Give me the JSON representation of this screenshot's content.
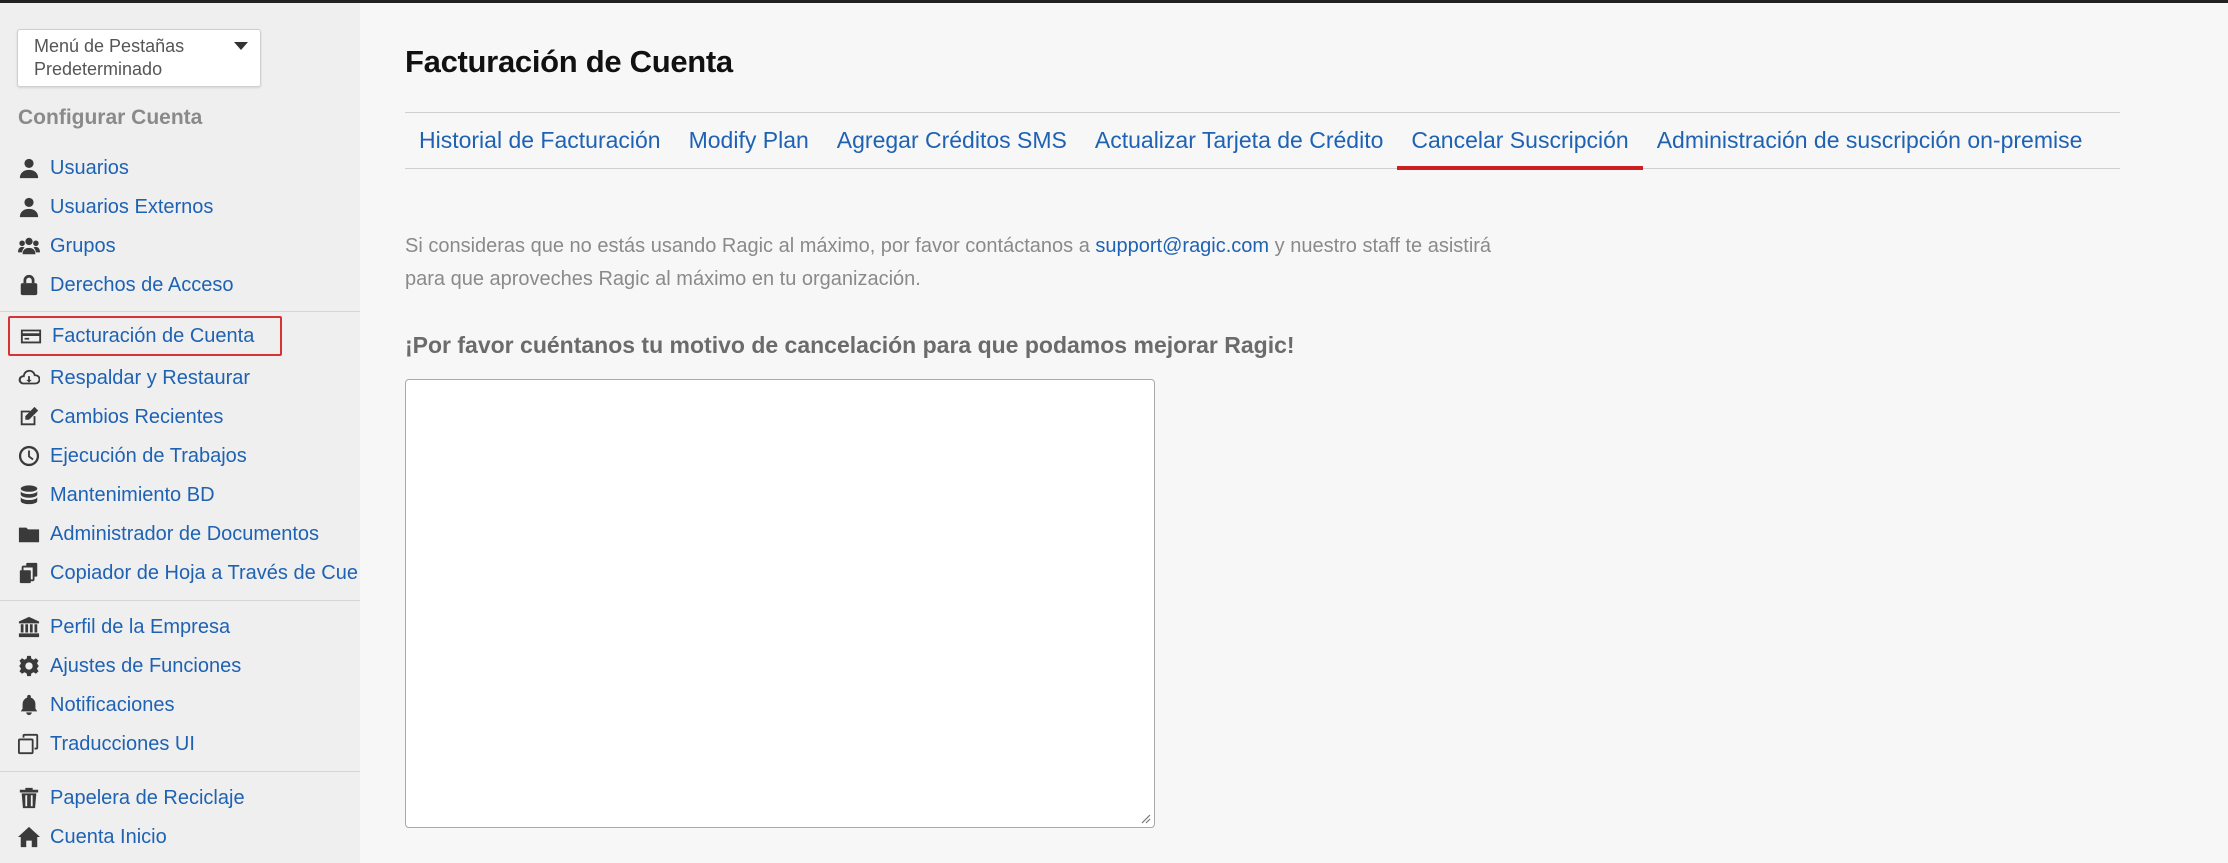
{
  "sidebar": {
    "tab_menu_label": "Menú de Pestañas Predeterminado",
    "section_title": "Configurar Cuenta",
    "items": [
      {
        "label": "Usuarios",
        "icon": "user-icon"
      },
      {
        "label": "Usuarios Externos",
        "icon": "user-icon"
      },
      {
        "label": "Grupos",
        "icon": "users-icon"
      },
      {
        "label": "Derechos de Acceso",
        "icon": "lock-icon"
      },
      {
        "label": "Facturación de Cuenta",
        "icon": "credit-card-icon",
        "active": true
      },
      {
        "label": "Respaldar y Restaurar",
        "icon": "cloud-download-icon"
      },
      {
        "label": "Cambios Recientes",
        "icon": "edit-icon"
      },
      {
        "label": "Ejecución de Trabajos",
        "icon": "clock-icon"
      },
      {
        "label": "Mantenimiento BD",
        "icon": "database-icon"
      },
      {
        "label": "Administrador de Documentos",
        "icon": "folder-icon"
      },
      {
        "label": "Copiador de Hoja a Través de Cue",
        "icon": "copy-sheets-icon"
      },
      {
        "label": "Perfil de la Empresa",
        "icon": "bank-icon"
      },
      {
        "label": "Ajustes de Funciones",
        "icon": "gear-icon"
      },
      {
        "label": "Notificaciones",
        "icon": "bell-icon"
      },
      {
        "label": "Traducciones UI",
        "icon": "translate-icon"
      },
      {
        "label": "Papelera de Reciclaje",
        "icon": "trash-icon"
      },
      {
        "label": "Cuenta Inicio",
        "icon": "home-icon"
      }
    ]
  },
  "main": {
    "title": "Facturación de Cuenta",
    "tabs": [
      {
        "label": "Historial de Facturación"
      },
      {
        "label": "Modify Plan"
      },
      {
        "label": "Agregar Créditos SMS"
      },
      {
        "label": "Actualizar Tarjeta de Crédito"
      },
      {
        "label": "Cancelar Suscripción",
        "active": true
      },
      {
        "label": "Administración de suscripción on-premise"
      }
    ],
    "intro_before": "Si consideras que no estás usando Ragic al máximo, por favor contáctanos a ",
    "intro_link": "support@ragic.com",
    "intro_after": " y nuestro staff te asistirá para que aproveches Ragic al máximo en tu organización.",
    "prompt": "¡Por favor cuéntanos tu motivo de cancelación para que podamos mejorar Ragic!",
    "reason_value": ""
  },
  "colors": {
    "link": "#1e62b4",
    "active_tab_underline": "#cc1f1f",
    "active_highlight": "#d93232"
  }
}
